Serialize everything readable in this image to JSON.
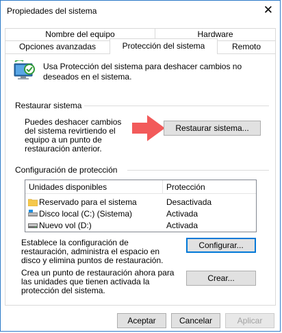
{
  "window": {
    "title": "Propiedades del sistema"
  },
  "tabs": {
    "row_back": [
      "Nombre del equipo",
      "Hardware"
    ],
    "row_front": [
      "Opciones avanzadas",
      "Protección del sistema",
      "Remoto"
    ],
    "active": "Protección del sistema"
  },
  "intro": {
    "text": "Usa Protección del sistema para deshacer cambios no deseados en el sistema."
  },
  "restore": {
    "title": "Restaurar sistema",
    "description": "Puedes deshacer cambios del sistema revirtiendo el equipo a un punto de restauración anterior.",
    "button": "Restaurar sistema..."
  },
  "protection": {
    "title": "Configuración de protección",
    "columns": [
      "Unidades disponibles",
      "Protección"
    ],
    "drives": [
      {
        "name": "Reservado para el sistema",
        "status": "Desactivada",
        "icon": "folder-icon"
      },
      {
        "name": "Disco local (C:) (Sistema)",
        "status": "Activada",
        "icon": "system-drive-icon"
      },
      {
        "name": "Nuevo vol (D:)",
        "status": "Activada",
        "icon": "drive-icon"
      }
    ],
    "configure_text": "Establece la configuración de restauración, administra el espacio en disco y elimina puntos de restauración.",
    "configure_button": "Configurar...",
    "create_text": "Crea un punto de restauración ahora para las unidades que tienen activada la protección del sistema.",
    "create_button": "Crear..."
  },
  "footer": {
    "ok": "Aceptar",
    "cancel": "Cancelar",
    "apply": "Aplicar"
  },
  "colors": {
    "accent": "#0078d7",
    "arrow": "#f25a5a",
    "folder": "#f5c84c"
  }
}
